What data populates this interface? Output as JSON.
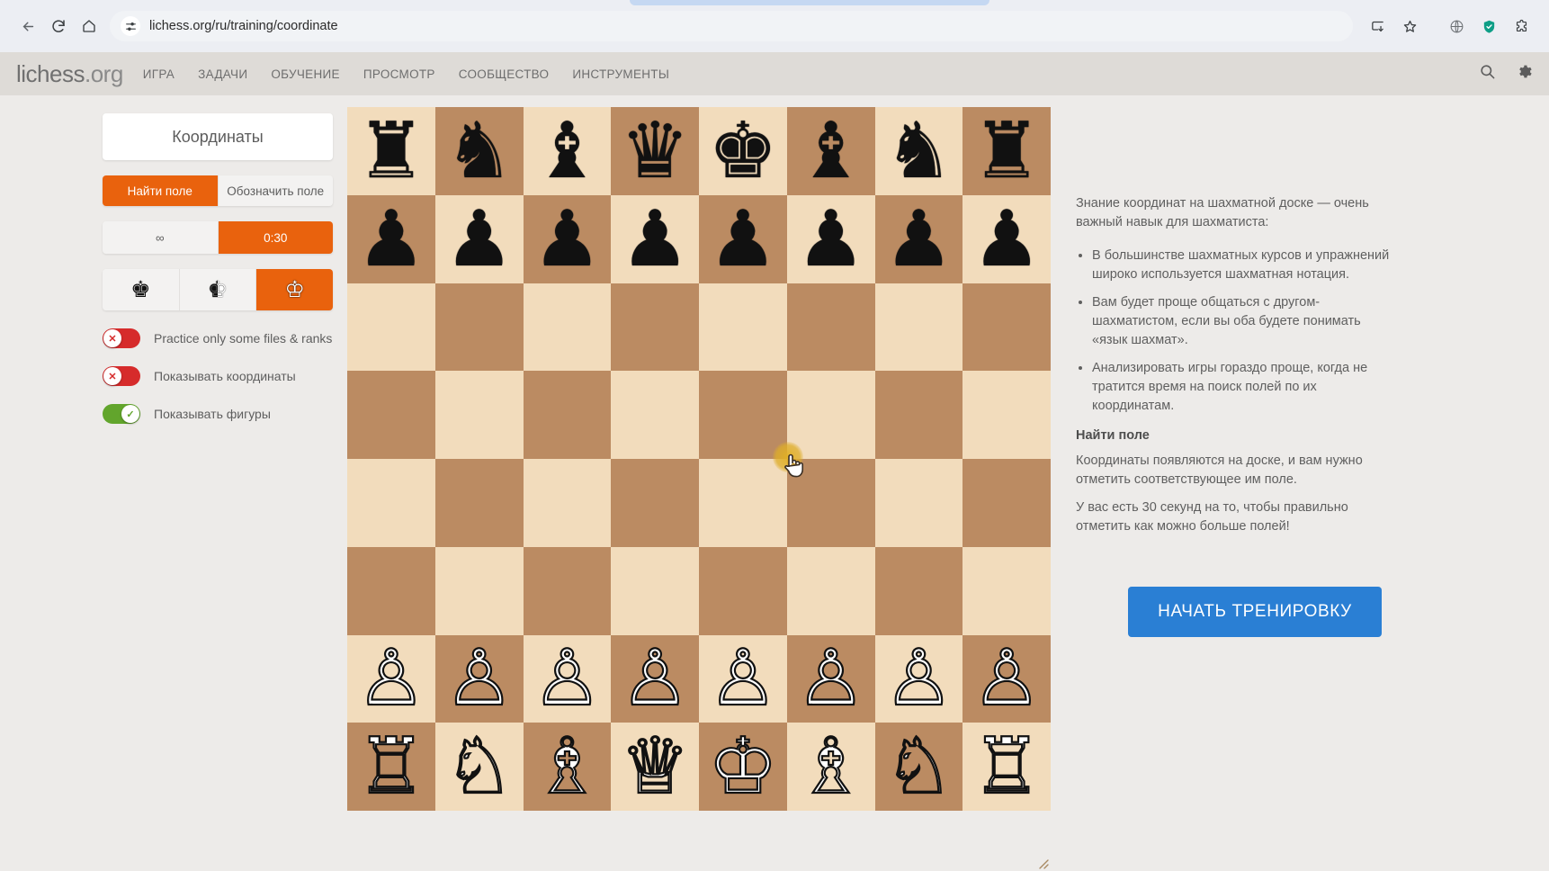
{
  "browser": {
    "back_icon": "back-arrow-icon",
    "reload_icon": "reload-icon",
    "home_icon": "home-icon",
    "site_settings_icon": "site-settings-icon",
    "url": "lichess.org/ru/training/coordinate",
    "install_icon": "install-app-icon",
    "bookmark_icon": "bookmark-star-icon",
    "globe_icon": "globe-icon",
    "shield_icon": "shield-icon",
    "extensions_icon": "extensions-icon"
  },
  "site_header": {
    "logo_main": "lichess",
    "logo_suffix": ".org",
    "nav": [
      {
        "label": "ИГРА"
      },
      {
        "label": "ЗАДАЧИ"
      },
      {
        "label": "ОБУЧЕНИЕ"
      },
      {
        "label": "ПРОСМОТР"
      },
      {
        "label": "СООБЩЕСТВО"
      },
      {
        "label": "ИНСТРУМЕНТЫ"
      }
    ],
    "search_icon": "search-icon",
    "settings_icon": "gear-icon"
  },
  "config": {
    "title": "Координаты",
    "mode_tabs": [
      {
        "label": "Найти поле",
        "active": true
      },
      {
        "label": "Обозначить поле",
        "active": false
      }
    ],
    "time_tabs": [
      {
        "label": "∞",
        "active": false
      },
      {
        "label": "0:30",
        "active": true
      }
    ],
    "color_tabs": [
      {
        "icon": "black-king-icon",
        "glyph": "♚",
        "variant": "black",
        "active": false
      },
      {
        "icon": "random-color-king-icon",
        "glyph": "♚",
        "variant": "mixed",
        "active": false
      },
      {
        "icon": "white-king-icon",
        "glyph": "♔",
        "variant": "white",
        "active": true
      }
    ],
    "toggles": [
      {
        "label": "Practice only some files & ranks",
        "on": false,
        "knob": "✕"
      },
      {
        "label": "Показывать координаты",
        "on": false,
        "knob": "✕"
      },
      {
        "label": "Показывать фигуры",
        "on": true,
        "knob": "✓"
      }
    ]
  },
  "board": {
    "rows": [
      [
        {
          "piece": "♜",
          "color": "b",
          "square": "a8"
        },
        {
          "piece": "♞",
          "color": "b",
          "square": "b8"
        },
        {
          "piece": "♝",
          "color": "b",
          "square": "c8"
        },
        {
          "piece": "♛",
          "color": "b",
          "square": "d8"
        },
        {
          "piece": "♚",
          "color": "b",
          "square": "e8"
        },
        {
          "piece": "♝",
          "color": "b",
          "square": "f8"
        },
        {
          "piece": "♞",
          "color": "b",
          "square": "g8"
        },
        {
          "piece": "♜",
          "color": "b",
          "square": "h8"
        }
      ],
      [
        {
          "piece": "♟",
          "color": "b",
          "square": "a7"
        },
        {
          "piece": "♟",
          "color": "b",
          "square": "b7"
        },
        {
          "piece": "♟",
          "color": "b",
          "square": "c7"
        },
        {
          "piece": "♟",
          "color": "b",
          "square": "d7"
        },
        {
          "piece": "♟",
          "color": "b",
          "square": "e7"
        },
        {
          "piece": "♟",
          "color": "b",
          "square": "f7"
        },
        {
          "piece": "♟",
          "color": "b",
          "square": "g7"
        },
        {
          "piece": "♟",
          "color": "b",
          "square": "h7"
        }
      ],
      [
        {
          "piece": "",
          "color": "",
          "square": "a6"
        },
        {
          "piece": "",
          "color": "",
          "square": "b6"
        },
        {
          "piece": "",
          "color": "",
          "square": "c6"
        },
        {
          "piece": "",
          "color": "",
          "square": "d6"
        },
        {
          "piece": "",
          "color": "",
          "square": "e6"
        },
        {
          "piece": "",
          "color": "",
          "square": "f6"
        },
        {
          "piece": "",
          "color": "",
          "square": "g6"
        },
        {
          "piece": "",
          "color": "",
          "square": "h6"
        }
      ],
      [
        {
          "piece": "",
          "color": "",
          "square": "a5"
        },
        {
          "piece": "",
          "color": "",
          "square": "b5"
        },
        {
          "piece": "",
          "color": "",
          "square": "c5"
        },
        {
          "piece": "",
          "color": "",
          "square": "d5"
        },
        {
          "piece": "",
          "color": "",
          "square": "e5"
        },
        {
          "piece": "",
          "color": "",
          "square": "f5"
        },
        {
          "piece": "",
          "color": "",
          "square": "g5"
        },
        {
          "piece": "",
          "color": "",
          "square": "h5"
        }
      ],
      [
        {
          "piece": "",
          "color": "",
          "square": "a4"
        },
        {
          "piece": "",
          "color": "",
          "square": "b4"
        },
        {
          "piece": "",
          "color": "",
          "square": "c4"
        },
        {
          "piece": "",
          "color": "",
          "square": "d4"
        },
        {
          "piece": "",
          "color": "",
          "square": "e4"
        },
        {
          "piece": "",
          "color": "",
          "square": "f4"
        },
        {
          "piece": "",
          "color": "",
          "square": "g4"
        },
        {
          "piece": "",
          "color": "",
          "square": "h4"
        }
      ],
      [
        {
          "piece": "",
          "color": "",
          "square": "a3"
        },
        {
          "piece": "",
          "color": "",
          "square": "b3"
        },
        {
          "piece": "",
          "color": "",
          "square": "c3"
        },
        {
          "piece": "",
          "color": "",
          "square": "d3"
        },
        {
          "piece": "",
          "color": "",
          "square": "e3"
        },
        {
          "piece": "",
          "color": "",
          "square": "f3"
        },
        {
          "piece": "",
          "color": "",
          "square": "g3"
        },
        {
          "piece": "",
          "color": "",
          "square": "h3"
        }
      ],
      [
        {
          "piece": "♙",
          "color": "w",
          "square": "a2"
        },
        {
          "piece": "♙",
          "color": "w",
          "square": "b2"
        },
        {
          "piece": "♙",
          "color": "w",
          "square": "c2"
        },
        {
          "piece": "♙",
          "color": "w",
          "square": "d2"
        },
        {
          "piece": "♙",
          "color": "w",
          "square": "e2"
        },
        {
          "piece": "♙",
          "color": "w",
          "square": "f2"
        },
        {
          "piece": "♙",
          "color": "w",
          "square": "g2"
        },
        {
          "piece": "♙",
          "color": "w",
          "square": "h2"
        }
      ],
      [
        {
          "piece": "♖",
          "color": "w",
          "square": "a1"
        },
        {
          "piece": "♘",
          "color": "w",
          "square": "b1"
        },
        {
          "piece": "♗",
          "color": "w",
          "square": "c1"
        },
        {
          "piece": "♕",
          "color": "w",
          "square": "d1"
        },
        {
          "piece": "♔",
          "color": "w",
          "square": "e1"
        },
        {
          "piece": "♗",
          "color": "w",
          "square": "f1"
        },
        {
          "piece": "♘",
          "color": "w",
          "square": "g1"
        },
        {
          "piece": "♖",
          "color": "w",
          "square": "h1"
        }
      ]
    ],
    "light_color": "#f2dcbc",
    "dark_color": "#bb8b62",
    "resize_handle_icon": "resize-handle-icon",
    "cursor_icon": "pointing-hand-cursor-icon",
    "click_highlight_color": "#e2b024"
  },
  "info": {
    "intro": "Знание координат на шахматной доске — очень важный навык для шахматиста:",
    "bullets": [
      "В большинстве шахматных курсов и упражнений широко используется шахматная нотация.",
      "Вам будет проще общаться с другом-шахматистом, если вы оба будете понимать «язык шахмат».",
      "Анализировать игры гораздо проще, когда не тратится время на поиск полей по их координатам."
    ],
    "subtitle": "Найти поле",
    "paragraph1": "Координаты появляются на доске, и вам нужно отметить соответствующее им поле.",
    "paragraph2": "У вас есть 30 секунд на то, чтобы правильно отметить как можно больше полей!",
    "start_button": "НАЧАТЬ ТРЕНИРОВКУ",
    "start_button_color": "#2a7fd4"
  }
}
